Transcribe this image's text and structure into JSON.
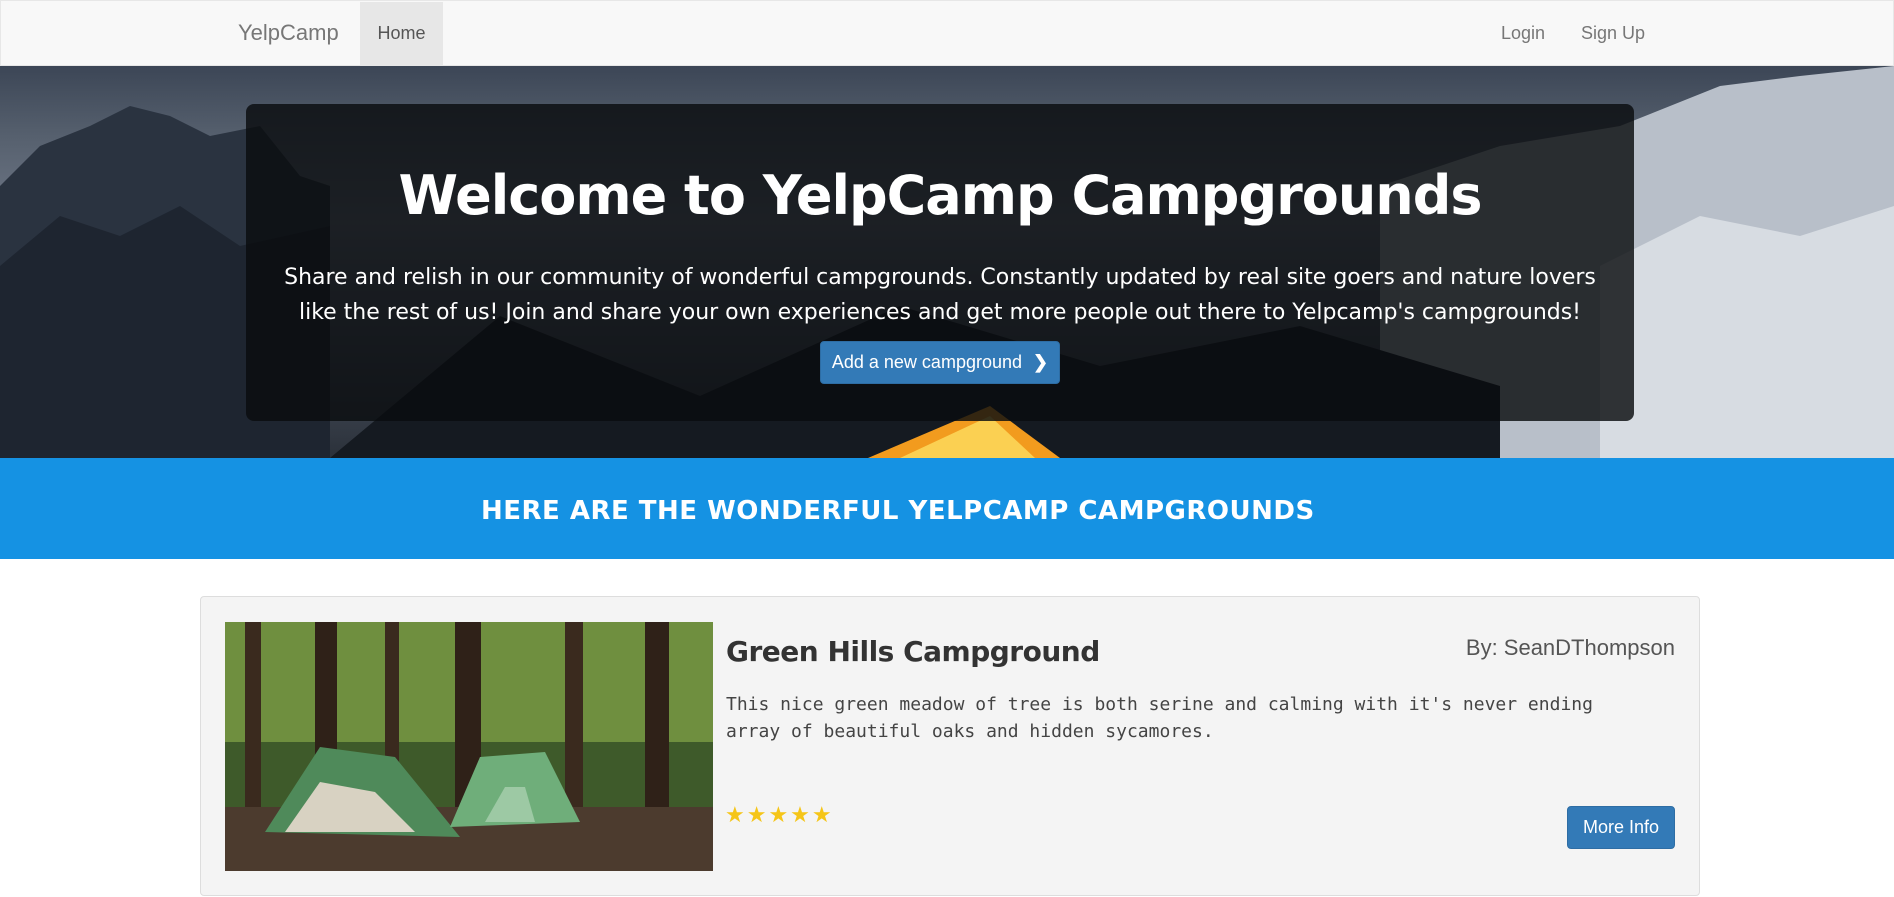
{
  "navbar": {
    "brand": "YelpCamp",
    "home": "Home",
    "login": "Login",
    "signup": "Sign Up"
  },
  "hero": {
    "title": "Welcome to YelpCamp Campgrounds",
    "description": "Share and relish in our community of wonderful campgrounds. Constantly updated by real site goers and nature lovers like the rest of us! Join and share your own experiences and get more people out there to Yelpcamp's campgrounds!",
    "button_label": "Add a new campground",
    "button_icon": "chevron-right-icon"
  },
  "band": {
    "title": "HERE ARE THE WONDERFUL YELPCAMP CAMPGROUNDS"
  },
  "campgrounds": [
    {
      "name": "Green Hills Campground",
      "author": "By: SeanDThompson",
      "description": "This nice green meadow of tree is both serine and calming with it's never ending array of beautiful oaks and hidden sycamores.",
      "rating": 5,
      "stars": "★★★★★",
      "more_label": "More Info"
    }
  ],
  "colors": {
    "accent": "#337ab7",
    "band": "#1592e3",
    "star": "#f5c518"
  }
}
